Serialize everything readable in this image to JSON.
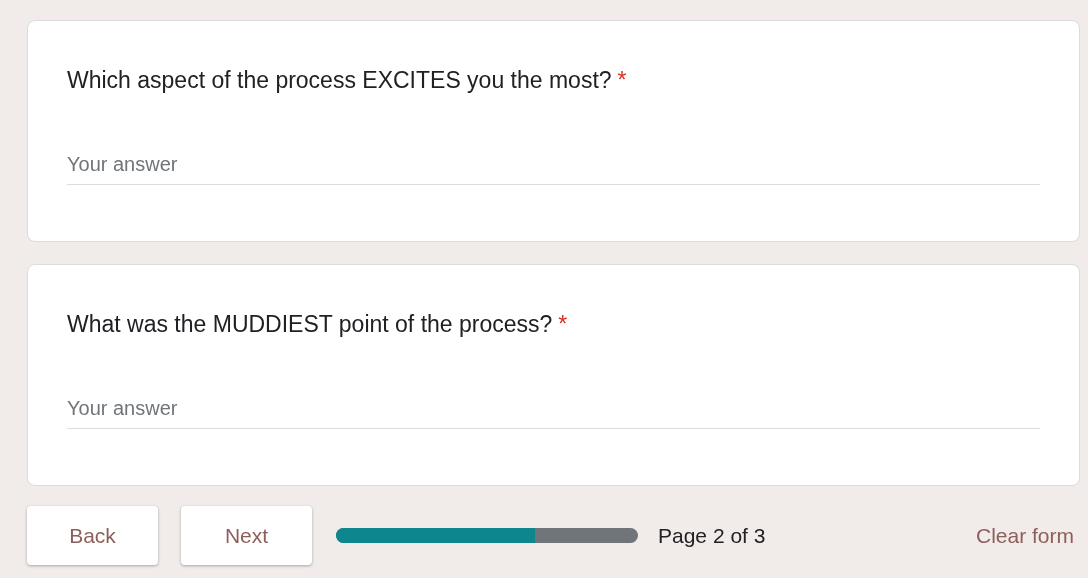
{
  "questions": [
    {
      "title": "Which aspect of the process EXCITES you the most?",
      "required": true,
      "answer": {
        "placeholder": "Your answer"
      }
    },
    {
      "title": "What was the MUDDIEST point of the process?",
      "required": true,
      "answer": {
        "placeholder": "Your answer"
      }
    }
  ],
  "required_mark": "*",
  "buttons": [
    "Back",
    "Next"
  ],
  "progress": {
    "level": 0.66,
    "label": "Page 2 of 3"
  },
  "clear_form": "Clear form"
}
